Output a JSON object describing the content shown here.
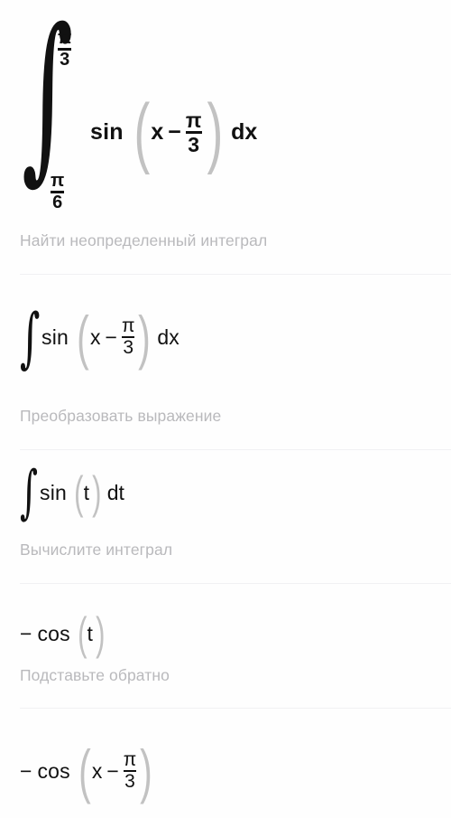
{
  "document": {
    "type": "integral-solution-steps",
    "language": "ru",
    "background_color": "#fefefe",
    "label_color": "#b9b9bc",
    "math_color": "#111111",
    "divider_color": "#f1f1f3",
    "paren_color": "#c2c2c2"
  },
  "main_expression": {
    "name": "definite-integral",
    "integral_sign": "∫",
    "upper_limit": {
      "numerator": "π",
      "denominator": "3"
    },
    "lower_limit": {
      "numerator": "π",
      "denominator": "6"
    },
    "function": "sin",
    "open_paren": "(",
    "variable": "x",
    "operator": "−",
    "fraction": {
      "numerator": "π",
      "denominator": "3"
    },
    "close_paren": ")",
    "differential": "dx",
    "plain_text": "∫ from π/6 to π/3 of sin(x − π/3) dx"
  },
  "steps": [
    {
      "label": "Найти неопределенный интеграл",
      "expression": {
        "integral_sign": "∫",
        "function": "sin",
        "open_paren": "(",
        "variable": "x",
        "operator": "−",
        "fraction": {
          "numerator": "π",
          "denominator": "3"
        },
        "close_paren": ")",
        "differential": "dx",
        "plain_text": "∫ sin(x − π/3) dx"
      }
    },
    {
      "label": "Преобразовать выражение",
      "expression": {
        "integral_sign": "∫",
        "function": "sin",
        "open_paren": "(",
        "variable": "t",
        "close_paren": ")",
        "differential": "dt",
        "plain_text": "∫ sin(t) dt"
      }
    },
    {
      "label": "Вычислите интеграл",
      "expression": {
        "sign": "−",
        "function": "cos",
        "open_paren": "(",
        "variable": "t",
        "close_paren": ")",
        "plain_text": "− cos(t)"
      }
    },
    {
      "label": "Подставьте обратно",
      "expression": {
        "sign": "−",
        "function": "cos",
        "open_paren": "(",
        "variable": "x",
        "operator": "−",
        "fraction": {
          "numerator": "π",
          "denominator": "3"
        },
        "close_paren": ")",
        "plain_text": "− cos(x − π/3)"
      }
    }
  ]
}
